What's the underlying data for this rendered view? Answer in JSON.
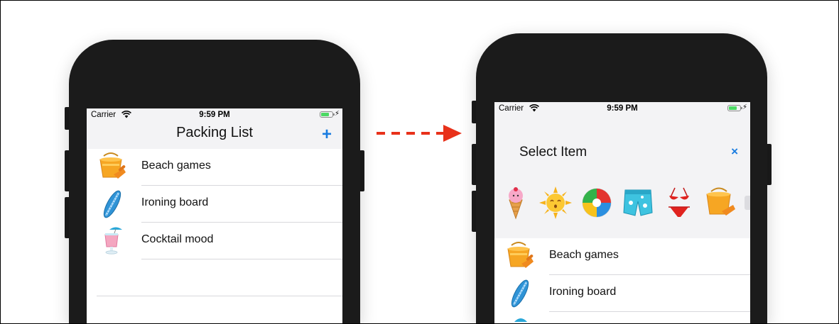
{
  "left_phone": {
    "status": {
      "carrier": "Carrier",
      "time": "9:59 PM"
    },
    "nav_title": "Packing List",
    "add_label": "+",
    "rows": [
      {
        "label": "Beach games",
        "icon": "bucket-icon"
      },
      {
        "label": "Ironing board",
        "icon": "surfboard-icon"
      },
      {
        "label": "Cocktail mood",
        "icon": "cocktail-icon"
      }
    ]
  },
  "right_phone": {
    "status": {
      "carrier": "Carrier",
      "time": "9:59 PM"
    },
    "picker_title": "Select Item",
    "close_label": "×",
    "emoji_icons": [
      "ice-cream-icon",
      "sun-icon",
      "beach-ball-icon",
      "swim-shorts-icon",
      "bikini-icon",
      "bucket-icon"
    ],
    "rows": [
      {
        "label": "Beach games",
        "icon": "bucket-icon"
      },
      {
        "label": "Ironing board",
        "icon": "surfboard-icon"
      }
    ]
  },
  "colors": {
    "accent": "#1a7ce0",
    "arrow": "#e8311a",
    "nav_bg": "#f3f3f5",
    "phone_body": "#1b1b1b"
  }
}
